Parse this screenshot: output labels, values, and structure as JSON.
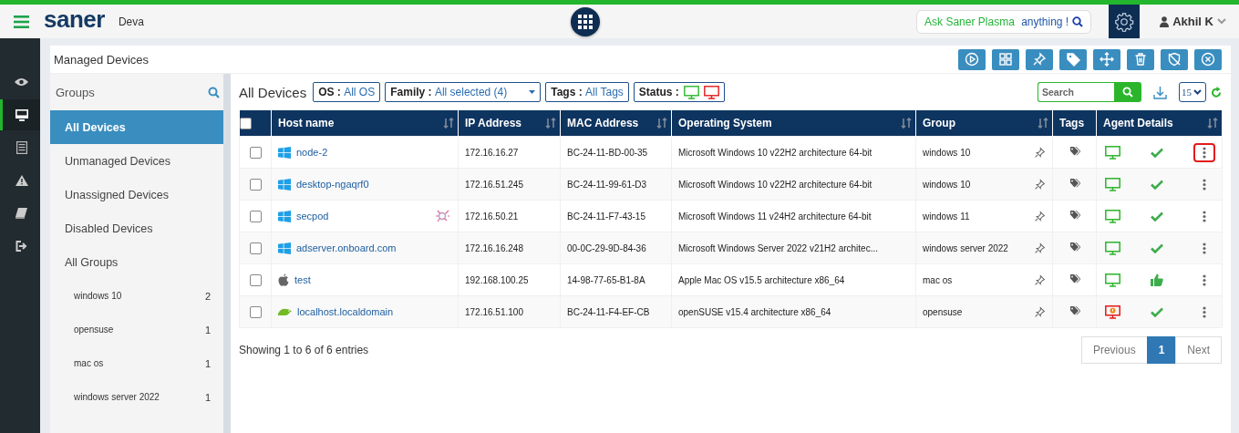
{
  "header": {
    "brand": "saner",
    "workspace": "Deva",
    "ask": {
      "lead": "Ask Saner Plasma",
      "tail": "anything !"
    },
    "user": "Akhil K"
  },
  "nav_rail": [
    {
      "kind": "eye",
      "selected": false
    },
    {
      "kind": "monitor",
      "selected": true
    },
    {
      "kind": "list",
      "selected": false
    },
    {
      "kind": "warning",
      "selected": false
    },
    {
      "kind": "book",
      "selected": false
    },
    {
      "kind": "logout",
      "selected": false
    }
  ],
  "panel": {
    "title": "Managed Devices",
    "toolbar": [
      {
        "kind": "play"
      },
      {
        "kind": "grid"
      },
      {
        "kind": "pin"
      },
      {
        "kind": "tag"
      },
      {
        "kind": "move"
      },
      {
        "kind": "trash"
      },
      {
        "kind": "shield-off"
      },
      {
        "kind": "close"
      }
    ]
  },
  "groups": {
    "title": "Groups",
    "items": [
      {
        "label": "All Devices",
        "selected": true
      },
      {
        "label": "Unmanaged Devices",
        "selected": false
      },
      {
        "label": "Unassigned Devices",
        "selected": false
      },
      {
        "label": "Disabled Devices",
        "selected": false
      },
      {
        "label": "All Groups",
        "selected": false
      }
    ],
    "group_list": [
      {
        "name": "windows 10",
        "count": "2"
      },
      {
        "name": "opensuse",
        "count": "1"
      },
      {
        "name": "mac os",
        "count": "1"
      },
      {
        "name": "windows server 2022",
        "count": "1"
      }
    ]
  },
  "filters": {
    "heading": "All Devices",
    "os": {
      "label": "OS :",
      "value": "All OS"
    },
    "family": {
      "label": "Family :",
      "value": "All selected (4)"
    },
    "tags": {
      "label": "Tags :",
      "value": "All Tags"
    },
    "status": {
      "label": "Status :"
    },
    "search": {
      "placeholder": "Search"
    },
    "page_size": "15"
  },
  "table": {
    "select_all": {
      "checked": false
    },
    "columns": [
      {
        "label": "Host name",
        "sortable": true
      },
      {
        "label": "IP Address",
        "sortable": true
      },
      {
        "label": "MAC Address",
        "sortable": true
      },
      {
        "label": "Operating System",
        "sortable": true
      },
      {
        "label": "Group",
        "sortable": true
      },
      {
        "label": "Tags",
        "sortable": false
      },
      {
        "label": "Agent Details",
        "sortable": true
      }
    ],
    "rows": [
      {
        "checked": false,
        "logo": {
          "kind": "windows"
        },
        "host": "node-2",
        "scan_badge": false,
        "ip": "172.16.16.27",
        "mac": "BC-24-11-BD-00-35",
        "os": "Microsoft Windows 10 v22H2 architecture 64-bit",
        "group": "windows 10",
        "agent": {
          "kind": "online"
        },
        "health": {
          "kind": "check"
        },
        "menu_highlighted": true
      },
      {
        "checked": false,
        "logo": {
          "kind": "windows"
        },
        "host": "desktop-ngaqrf0",
        "scan_badge": false,
        "ip": "172.16.51.245",
        "mac": "BC-24-11-99-61-D3",
        "os": "Microsoft Windows 10 v22H2 architecture 64-bit",
        "group": "windows 10",
        "agent": {
          "kind": "online"
        },
        "health": {
          "kind": "check"
        },
        "menu_highlighted": false
      },
      {
        "checked": false,
        "logo": {
          "kind": "windows"
        },
        "host": "secpod",
        "scan_badge": true,
        "ip": "172.16.50.21",
        "mac": "BC-24-11-F7-43-15",
        "os": "Microsoft Windows 11 v24H2 architecture 64-bit",
        "group": "windows 11",
        "agent": {
          "kind": "online"
        },
        "health": {
          "kind": "check"
        },
        "menu_highlighted": false
      },
      {
        "checked": false,
        "logo": {
          "kind": "windows"
        },
        "host": "adserver.onboard.com",
        "scan_badge": false,
        "ip": "172.16.16.248",
        "mac": "00-0C-29-9D-84-36",
        "os": "Microsoft Windows Server 2022 v21H2 architec...",
        "group": "windows server 2022",
        "agent": {
          "kind": "online"
        },
        "health": {
          "kind": "check"
        },
        "menu_highlighted": false
      },
      {
        "checked": false,
        "logo": {
          "kind": "apple"
        },
        "host": "test",
        "scan_badge": false,
        "ip": "192.168.100.25",
        "mac": "14-98-77-65-B1-8A",
        "os": "Apple Mac OS v15.5 architecture x86_64",
        "group": "mac os",
        "agent": {
          "kind": "online"
        },
        "health": {
          "kind": "thumbs"
        },
        "menu_highlighted": false
      },
      {
        "checked": false,
        "logo": {
          "kind": "suse"
        },
        "host": "localhost.localdomain",
        "scan_badge": false,
        "ip": "172.16.51.100",
        "mac": "BC-24-11-F4-EF-CB",
        "os": "openSUSE v15.4 architecture x86_64",
        "group": "opensuse",
        "agent": {
          "kind": "alert"
        },
        "health": {
          "kind": "check"
        },
        "menu_highlighted": false
      }
    ]
  },
  "footer": {
    "summary": "Showing 1 to 6 of 6 entries",
    "pages": [
      {
        "label": "Previous",
        "selected": false
      },
      {
        "label": "1",
        "selected": true
      },
      {
        "label": "Next",
        "selected": false
      }
    ]
  }
}
